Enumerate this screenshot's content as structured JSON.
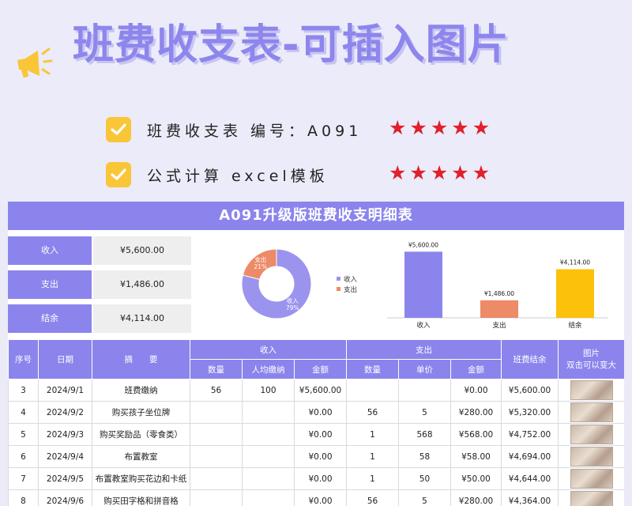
{
  "header": {
    "title": "班费收支表-可插入图片",
    "features": [
      {
        "text": "班费收支表  编号：A091",
        "stars": 5
      },
      {
        "text": "公式计算  excel模板",
        "stars": 5
      }
    ],
    "colors": {
      "accent": "#8b84ec",
      "check": "#f9c637",
      "star": "#e0202a"
    }
  },
  "panel": {
    "title": "A091升级版班费收支明细表",
    "summary": [
      {
        "label": "收入",
        "value": "¥5,600.00"
      },
      {
        "label": "支出",
        "value": "¥1,486.00"
      },
      {
        "label": "结余",
        "value": "¥4,114.00"
      }
    ]
  },
  "chart_data": [
    {
      "type": "pie",
      "title": "",
      "labels": [
        "收入",
        "支出"
      ],
      "values": [
        79,
        21
      ],
      "slice_labels": [
        "收入\n79%",
        "支出\n21%"
      ],
      "legend": [
        "收入",
        "支出"
      ],
      "legend_position": "right",
      "colors": [
        "#9b94ee",
        "#ed8a67"
      ]
    },
    {
      "type": "bar",
      "title": "",
      "categories": [
        "收入",
        "支出",
        "结余"
      ],
      "values": [
        5600,
        1486,
        4114
      ],
      "data_labels": [
        "¥5,600.00",
        "¥1,486.00",
        "¥4,114.00"
      ],
      "colors": [
        "#8b84ec",
        "#ed8a67",
        "#fcc10a"
      ],
      "ylim": [
        0,
        6000
      ],
      "grid": false
    }
  ],
  "table": {
    "group_headers": {
      "seq": "序号",
      "date": "日期",
      "summary": "摘　　要",
      "income": "收入",
      "expense": "支出",
      "balance": "班费结余",
      "image": "图片\n双击可以变大"
    },
    "sub_headers": {
      "in_qty": "数量",
      "in_avg": "人均缴纳",
      "in_amount": "金额",
      "out_qty": "数量",
      "out_price": "单价",
      "out_amount": "金额"
    },
    "rows": [
      {
        "seq": "3",
        "date": "2024/9/1",
        "desc": "班费缴纳",
        "in_qty": "56",
        "in_avg": "100",
        "in_amount": "¥5,600.00",
        "out_qty": "",
        "out_price": "",
        "out_amount": "¥0.00",
        "balance": "¥5,600.00"
      },
      {
        "seq": "4",
        "date": "2024/9/2",
        "desc": "购买孩子坐位牌",
        "in_qty": "",
        "in_avg": "",
        "in_amount": "¥0.00",
        "out_qty": "56",
        "out_price": "5",
        "out_amount": "¥280.00",
        "balance": "¥5,320.00"
      },
      {
        "seq": "5",
        "date": "2024/9/3",
        "desc": "购买奖励品（零食类）",
        "in_qty": "",
        "in_avg": "",
        "in_amount": "¥0.00",
        "out_qty": "1",
        "out_price": "568",
        "out_amount": "¥568.00",
        "balance": "¥4,752.00"
      },
      {
        "seq": "6",
        "date": "2024/9/4",
        "desc": "布置教室",
        "in_qty": "",
        "in_avg": "",
        "in_amount": "¥0.00",
        "out_qty": "1",
        "out_price": "58",
        "out_amount": "¥58.00",
        "balance": "¥4,694.00"
      },
      {
        "seq": "7",
        "date": "2024/9/5",
        "desc": "布置教室购买花边和卡纸",
        "in_qty": "",
        "in_avg": "",
        "in_amount": "¥0.00",
        "out_qty": "1",
        "out_price": "50",
        "out_amount": "¥50.00",
        "balance": "¥4,644.00"
      },
      {
        "seq": "8",
        "date": "2024/9/6",
        "desc": "购买田字格和拼音格",
        "in_qty": "",
        "in_avg": "",
        "in_amount": "¥0.00",
        "out_qty": "56",
        "out_price": "5",
        "out_amount": "¥280.00",
        "balance": "¥4,364.00"
      }
    ]
  }
}
